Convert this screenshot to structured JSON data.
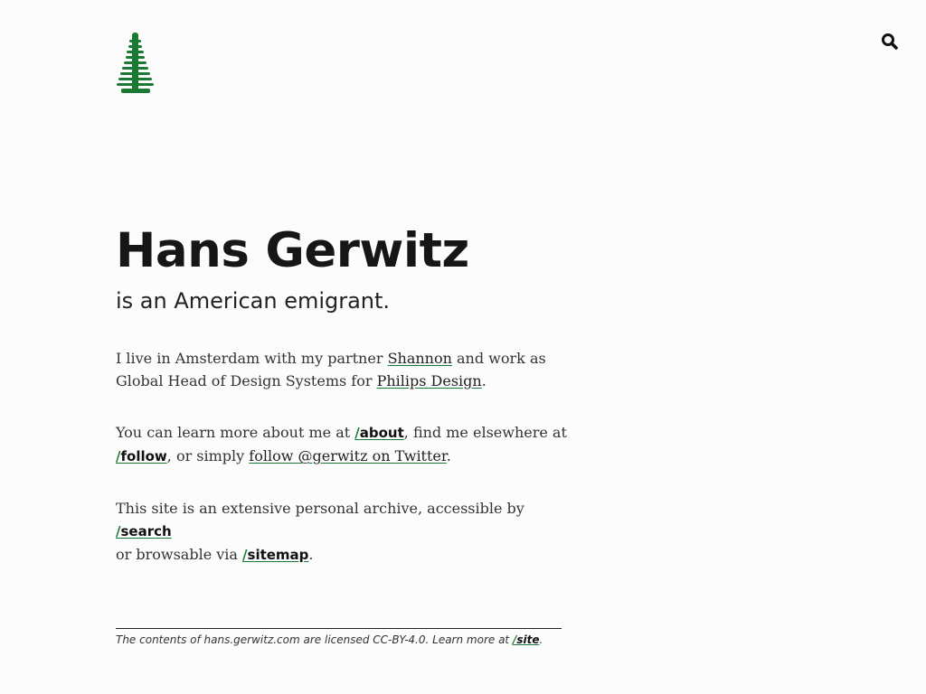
{
  "site": {
    "logo_icon": "pine-tree-icon",
    "search_icon": "search-icon",
    "accent_color": "#1a7a33"
  },
  "hero": {
    "name": "Hans Gerwitz",
    "tagline": "is an American emigrant."
  },
  "intro": {
    "p1_text1": "I live in Amsterdam with my partner ",
    "p1_link1": "Shannon",
    "p1_text2": " and work as Global Head of Design Systems for ",
    "p1_link2": "Philips Design",
    "p1_text3": ".",
    "p2_text1": "You can learn more about me at ",
    "p2_link1_slash": "/",
    "p2_link1": "about",
    "p2_text2": ", find me elsewhere at ",
    "p2_link2_slash": "/",
    "p2_link2": "follow",
    "p2_text3": ", or simply ",
    "p2_link3": "follow @gerwitz on Twitter",
    "p2_text4": ".",
    "p3_text1": "This site is an extensive personal archive, accessible by ",
    "p3_link1_slash": "/",
    "p3_link1": "search",
    "p3_text2": " or browsable via ",
    "p3_link2_slash": "/",
    "p3_link2": "sitemap",
    "p3_text3": "."
  },
  "footer": {
    "text": "The contents of hans.gerwitz.com are licensed CC-BY-4.0. Learn more at ",
    "link_slash": "/",
    "link": "site",
    "end": "."
  }
}
